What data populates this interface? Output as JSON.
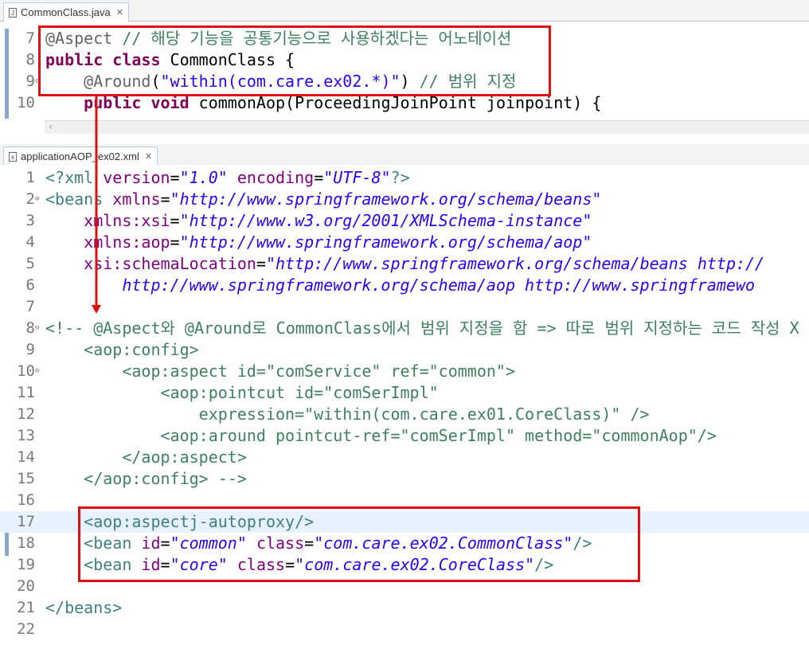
{
  "java_tab": {
    "title": "CommonClass.java",
    "icon": "java-file-icon"
  },
  "java_lines": [
    {
      "n": "7",
      "spans": [
        [
          "ann",
          "@Aspect"
        ],
        [
          "pun",
          " "
        ],
        [
          "cmt",
          "// 해당 기능을 공통기능으로 사용하겠다는 어노테이션"
        ]
      ]
    },
    {
      "n": "8",
      "spans": [
        [
          "kw",
          "public"
        ],
        [
          "pun",
          " "
        ],
        [
          "kw",
          "class"
        ],
        [
          "pun",
          " CommonClass {"
        ]
      ]
    },
    {
      "n": "9",
      "fold": true,
      "spans": [
        [
          "pun",
          "    "
        ],
        [
          "ann",
          "@Around"
        ],
        [
          "pun",
          "("
        ],
        [
          "str",
          "\"within(com.care.ex02.*)\""
        ],
        [
          "pun",
          ") "
        ],
        [
          "cmt",
          "// 범위 지정"
        ]
      ]
    },
    {
      "n": "10",
      "spans": [
        [
          "pun",
          "    "
        ],
        [
          "kw",
          "public"
        ],
        [
          "pun",
          " "
        ],
        [
          "kw",
          "void"
        ],
        [
          "pun",
          " commonAop(ProceedingJoinPoint joinpoint) {"
        ]
      ]
    }
  ],
  "xml_tab": {
    "title": "applicationAOP_ex02.xml",
    "icon": "xml-file-icon"
  },
  "xml_lines": [
    {
      "n": "1",
      "spans": [
        [
          "tag",
          "<?xml "
        ],
        [
          "attr",
          "version"
        ],
        [
          "pun",
          "="
        ],
        [
          "val",
          "\"1.0\""
        ],
        [
          "pun",
          " "
        ],
        [
          "attr",
          "encoding"
        ],
        [
          "pun",
          "="
        ],
        [
          "val",
          "\"UTF-8\""
        ],
        [
          "tag",
          "?>"
        ]
      ]
    },
    {
      "n": "2",
      "fold": true,
      "spans": [
        [
          "tag",
          "<beans "
        ],
        [
          "attr",
          "xmlns"
        ],
        [
          "pun",
          "="
        ],
        [
          "val",
          "\"http://www.springframework.org/schema/beans\""
        ]
      ]
    },
    {
      "n": "3",
      "spans": [
        [
          "pun",
          "    "
        ],
        [
          "attr",
          "xmlns:xsi"
        ],
        [
          "pun",
          "="
        ],
        [
          "val",
          "\"http://www.w3.org/2001/XMLSchema-instance\""
        ]
      ]
    },
    {
      "n": "4",
      "spans": [
        [
          "pun",
          "    "
        ],
        [
          "attr",
          "xmlns:aop"
        ],
        [
          "pun",
          "="
        ],
        [
          "val",
          "\"http://www.springframework.org/schema/aop\""
        ]
      ]
    },
    {
      "n": "5",
      "spans": [
        [
          "pun",
          "    "
        ],
        [
          "attr",
          "xsi:schemaLocation"
        ],
        [
          "pun",
          "="
        ],
        [
          "val",
          "\"http://www.springframework.org/schema/beans http://"
        ]
      ]
    },
    {
      "n": "6",
      "spans": [
        [
          "pun",
          "        "
        ],
        [
          "val",
          "http://www.springframework.org/schema/aop http://www.springframewo"
        ]
      ]
    },
    {
      "n": "7",
      "spans": []
    },
    {
      "n": "8",
      "fold": true,
      "spans": [
        [
          "cmt",
          "<!-- @Aspect와 @Around로 CommonClass에서 범위 지정을 함 => 따로 범위 지정하는 코드 작성 X"
        ]
      ]
    },
    {
      "n": "9",
      "spans": [
        [
          "cmt",
          "    <aop:config>"
        ]
      ]
    },
    {
      "n": "10",
      "fold": true,
      "spans": [
        [
          "cmt",
          "        <aop:aspect id=\"comService\" ref=\"common\">"
        ]
      ]
    },
    {
      "n": "11",
      "spans": [
        [
          "cmt",
          "            <aop:pointcut id=\"comSerImpl\""
        ]
      ]
    },
    {
      "n": "12",
      "spans": [
        [
          "cmt",
          "                expression=\"within(com.care.ex01.CoreClass)\" />"
        ]
      ]
    },
    {
      "n": "13",
      "spans": [
        [
          "cmt",
          "            <aop:around pointcut-ref=\"comSerImpl\" method=\"commonAop\"/>"
        ]
      ]
    },
    {
      "n": "14",
      "spans": [
        [
          "cmt",
          "        </aop:aspect>"
        ]
      ]
    },
    {
      "n": "15",
      "spans": [
        [
          "cmt",
          "    </aop:config> -->"
        ]
      ]
    },
    {
      "n": "16",
      "spans": []
    },
    {
      "n": "17",
      "hl": true,
      "spans": [
        [
          "pun",
          "    "
        ],
        [
          "tag",
          "<aop:aspectj-autoproxy/>"
        ]
      ]
    },
    {
      "n": "18",
      "spans": [
        [
          "pun",
          "    "
        ],
        [
          "tag",
          "<bean "
        ],
        [
          "attr",
          "id"
        ],
        [
          "pun",
          "="
        ],
        [
          "val",
          "\"common\""
        ],
        [
          "pun",
          " "
        ],
        [
          "attr",
          "class"
        ],
        [
          "pun",
          "="
        ],
        [
          "val",
          "\"com.care.ex02.CommonClass\""
        ],
        [
          "tag",
          "/>"
        ]
      ]
    },
    {
      "n": "19",
      "spans": [
        [
          "pun",
          "    "
        ],
        [
          "tag",
          "<bean "
        ],
        [
          "attr",
          "id"
        ],
        [
          "pun",
          "="
        ],
        [
          "val",
          "\"core\""
        ],
        [
          "pun",
          " "
        ],
        [
          "attr",
          "class"
        ],
        [
          "pun",
          "="
        ],
        [
          "val",
          "\"com.care.ex02.CoreClass\""
        ],
        [
          "tag",
          "/>"
        ]
      ]
    },
    {
      "n": "20",
      "spans": []
    },
    {
      "n": "21",
      "spans": [
        [
          "tag",
          "</beans>"
        ]
      ]
    },
    {
      "n": "22",
      "spans": []
    }
  ],
  "colors": {
    "annotation_box": "#e01010",
    "arrow": "#e01010"
  }
}
